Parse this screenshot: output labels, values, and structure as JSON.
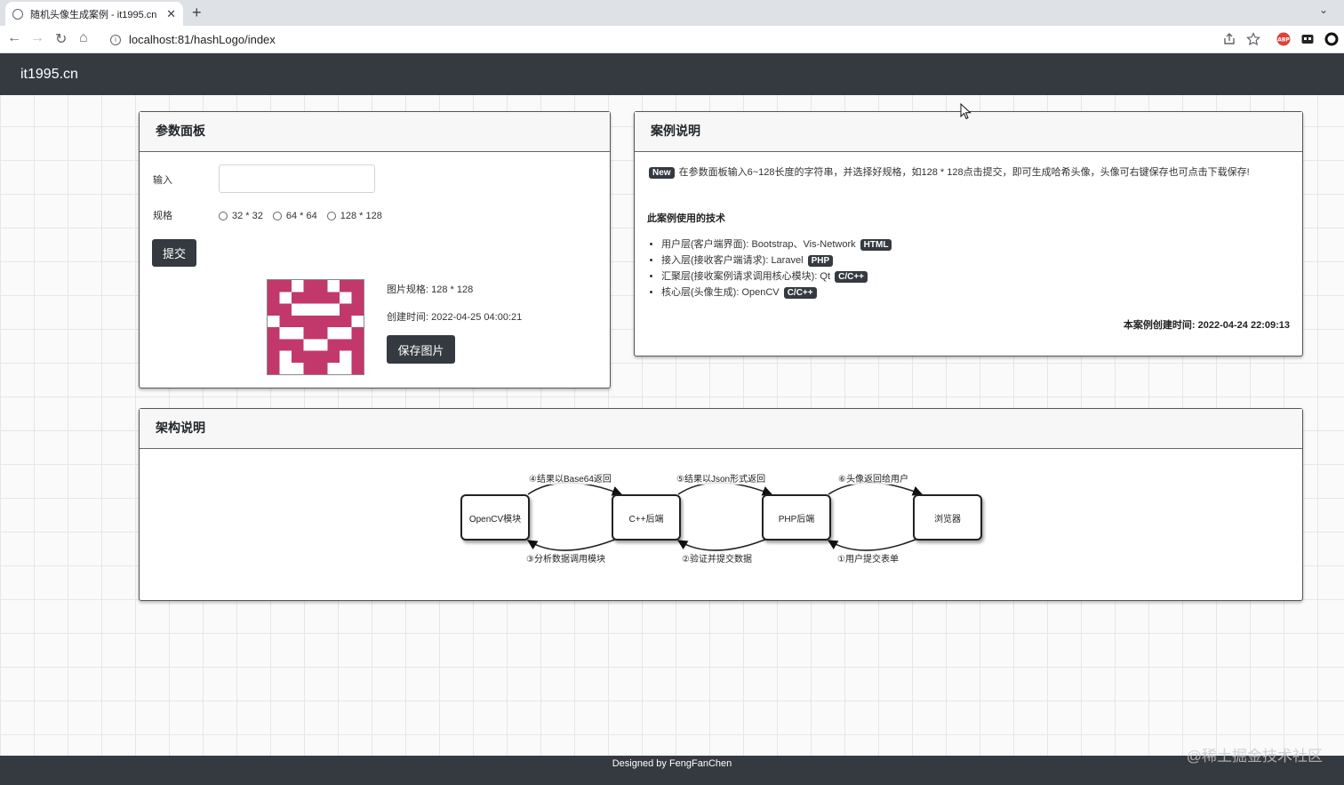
{
  "browser": {
    "tab_title": "随机头像生成案例 - it1995.cn",
    "tab_close": "✕",
    "new_tab": "+",
    "url": "localhost:81/hashLogo/index",
    "nav_back": "←",
    "nav_forward": "→",
    "nav_reload": "↻",
    "nav_home": "⌂",
    "menu_down": "⌄"
  },
  "navbar": {
    "brand": "it1995.cn"
  },
  "params_panel": {
    "title": "参数面板",
    "input_label": "输入",
    "input_value": "",
    "spec_label": "规格",
    "spec_options": [
      "32 * 32",
      "64 * 64",
      "128 * 128"
    ],
    "submit": "提交",
    "image_spec": "图片规格: 128 * 128",
    "created_time": "创建时间: 2022-04-25 04:00:21",
    "save_button": "保存图片",
    "avatar_color": "#c2386a"
  },
  "case_panel": {
    "title": "案例说明",
    "new_badge": "New",
    "description": "在参数面板输入6~128长度的字符串，并选择好规格，如128 * 128点击提交，即可生成哈希头像，头像可右键保存也可点击下载保存!",
    "tech_title": "此案例使用的技术",
    "tech_items": [
      {
        "text": "用户层(客户端界面): Bootstrap、Vis-Network",
        "badge": "HTML"
      },
      {
        "text": "接入层(接收客户端请求): Laravel",
        "badge": "PHP"
      },
      {
        "text": "汇聚层(接收案例请求调用核心模块): Qt",
        "badge": "C/C++"
      },
      {
        "text": "核心层(头像生成): OpenCV",
        "badge": "C/C++"
      }
    ],
    "created": "本案例创建时间: 2022-04-24 22:09:13"
  },
  "arch_panel": {
    "title": "架构说明",
    "nodes": [
      "OpenCV模块",
      "C++后端",
      "PHP后端",
      "浏览器"
    ],
    "edges": {
      "e1": "①用户提交表单",
      "e2": "②验证并提交数据",
      "e3": "③分析数据调用模块",
      "e4": "④结果以Base64返回",
      "e5": "⑤结果以Json形式返回",
      "e6": "⑥头像返回给用户"
    }
  },
  "footer": {
    "text": "Designed by FengFanChen"
  },
  "watermark": "@稀土掘金技术社区"
}
